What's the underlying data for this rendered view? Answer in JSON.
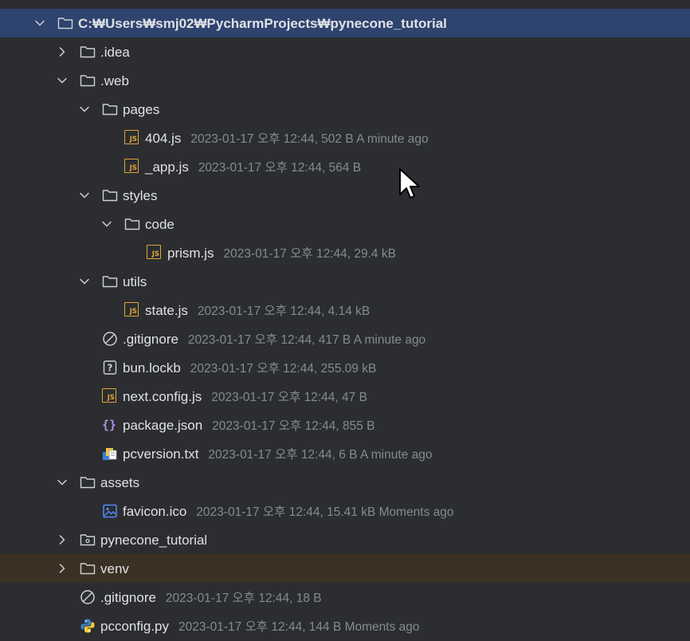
{
  "tree": {
    "rows": [
      {
        "name": "C:₩Users₩smj02₩PycharmProjects₩pynecone_tutorial",
        "meta": "",
        "icon": "folder-icon",
        "chevron": "down",
        "level": 0
      },
      {
        "name": ".idea",
        "meta": "",
        "icon": "folder-icon",
        "chevron": "right",
        "level": 1
      },
      {
        "name": ".web",
        "meta": "",
        "icon": "folder-icon",
        "chevron": "down",
        "level": 1
      },
      {
        "name": "pages",
        "meta": "",
        "icon": "folder-icon",
        "chevron": "down",
        "level": 2
      },
      {
        "name": "404.js",
        "meta": "2023-01-17 오후 12:44, 502 B A minute ago",
        "icon": "js-file-icon",
        "chevron": "",
        "level": 3
      },
      {
        "name": "_app.js",
        "meta": "2023-01-17 오후 12:44, 564 B",
        "icon": "js-file-icon",
        "chevron": "",
        "level": 3
      },
      {
        "name": "styles",
        "meta": "",
        "icon": "folder-icon",
        "chevron": "down",
        "level": 2
      },
      {
        "name": "code",
        "meta": "",
        "icon": "folder-icon",
        "chevron": "down",
        "level": 3
      },
      {
        "name": "prism.js",
        "meta": "2023-01-17 오후 12:44, 29.4 kB",
        "icon": "js-file-icon",
        "chevron": "",
        "level": 4
      },
      {
        "name": "utils",
        "meta": "",
        "icon": "folder-icon",
        "chevron": "down",
        "level": 2
      },
      {
        "name": "state.js",
        "meta": "2023-01-17 오후 12:44, 4.14 kB",
        "icon": "js-file-icon",
        "chevron": "",
        "level": 3
      },
      {
        "name": ".gitignore",
        "meta": "2023-01-17 오후 12:44, 417 B A minute ago",
        "icon": "ignore-file-icon",
        "chevron": "",
        "level": 2
      },
      {
        "name": "bun.lockb",
        "meta": "2023-01-17 오후 12:44, 255.09 kB",
        "icon": "unknown-file-icon",
        "chevron": "",
        "level": 2
      },
      {
        "name": "next.config.js",
        "meta": "2023-01-17 오후 12:44, 47 B",
        "icon": "js-file-icon",
        "chevron": "",
        "level": 2
      },
      {
        "name": "package.json",
        "meta": "2023-01-17 오후 12:44, 855 B",
        "icon": "json-file-icon",
        "chevron": "",
        "level": 2
      },
      {
        "name": "pcversion.txt",
        "meta": "2023-01-17 오후 12:44, 6 B A minute ago",
        "icon": "text-file-icon",
        "chevron": "",
        "level": 2
      },
      {
        "name": "assets",
        "meta": "",
        "icon": "folder-icon",
        "chevron": "down",
        "level": 1
      },
      {
        "name": "favicon.ico",
        "meta": "2023-01-17 오후 12:44, 15.41 kB Moments ago",
        "icon": "image-file-icon",
        "chevron": "",
        "level": 2
      },
      {
        "name": "pynecone_tutorial",
        "meta": "",
        "icon": "package-folder-icon",
        "chevron": "right",
        "level": 1
      },
      {
        "name": "venv",
        "meta": "",
        "icon": "folder-icon",
        "chevron": "right",
        "level": 1
      },
      {
        "name": ".gitignore",
        "meta": "2023-01-17 오후 12:44, 18 B",
        "icon": "ignore-file-icon",
        "chevron": "",
        "level": 1
      },
      {
        "name": "pcconfig.py",
        "meta": "2023-01-17 오후 12:44, 144 B Moments ago",
        "icon": "python-file-icon",
        "chevron": "",
        "level": 1
      }
    ]
  },
  "colors": {
    "background": "#2b2d30",
    "selected_row": "#2e436e",
    "highlight_row": "#3a3124",
    "text": "#dfe1e5",
    "meta_text": "#868a91",
    "js_badge": "#e3a43b",
    "json_braces": "#b48ee8",
    "image_icon": "#548af7"
  }
}
